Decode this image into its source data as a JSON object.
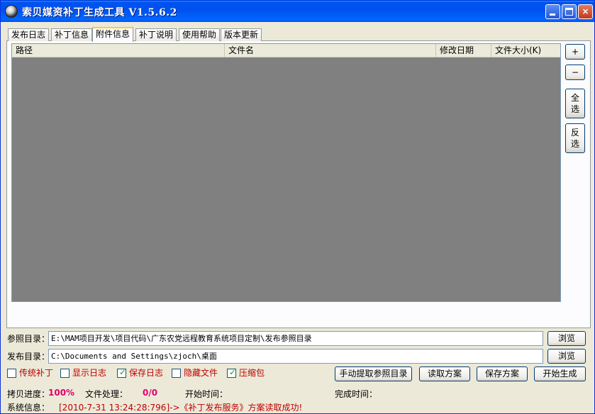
{
  "window": {
    "title": "索贝媒资补丁生成工具 V1.5.6.2",
    "controls": {
      "minimize": "",
      "maximize": "",
      "close": "×"
    }
  },
  "tabs": [
    {
      "label": "发布日志",
      "active": false
    },
    {
      "label": "补丁信息",
      "active": false
    },
    {
      "label": "附件信息",
      "active": true
    },
    {
      "label": "补丁说明",
      "active": false
    },
    {
      "label": "使用帮助",
      "active": false
    },
    {
      "label": "版本更新",
      "active": false
    }
  ],
  "list": {
    "columns": [
      "路径",
      "文件名",
      "修改日期",
      "文件大小(K)"
    ],
    "rows": []
  },
  "side_buttons": {
    "add": "+",
    "remove": "−",
    "select_all": [
      "全",
      "选"
    ],
    "invert": [
      "反",
      "选"
    ]
  },
  "reference_dir": {
    "label": "参照目录：",
    "value": "E:\\MAM项目开发\\项目代码\\广东农党远程教育系统项目定制\\发布参照目录",
    "browse": "浏览"
  },
  "publish_dir": {
    "label": "发布目录：",
    "value": "C:\\Documents and Settings\\zjoch\\桌面",
    "browse": "浏览"
  },
  "options": [
    {
      "label": "传统补丁",
      "checked": false
    },
    {
      "label": "显示日志",
      "checked": false
    },
    {
      "label": "保存日志",
      "checked": true
    },
    {
      "label": "隐藏文件",
      "checked": false
    },
    {
      "label": "压缩包",
      "checked": true
    }
  ],
  "actions": {
    "extract": "手动提取参照目录",
    "load": "读取方案",
    "save": "保存方案",
    "start": "开始生成"
  },
  "status": {
    "copy_progress_label": "拷贝进度：",
    "copy_progress_value": "100%",
    "file_process_label": "文件处理：",
    "file_process_value": "0/0",
    "start_time_label": "开始时间：",
    "start_time_value": "",
    "end_time_label": "完成时间：",
    "end_time_value": "",
    "system_info_label": "系统信息：",
    "system_info_value": "[2010-7-31 13:24:28:796]->《补丁发布服务》方案读取成功!"
  }
}
